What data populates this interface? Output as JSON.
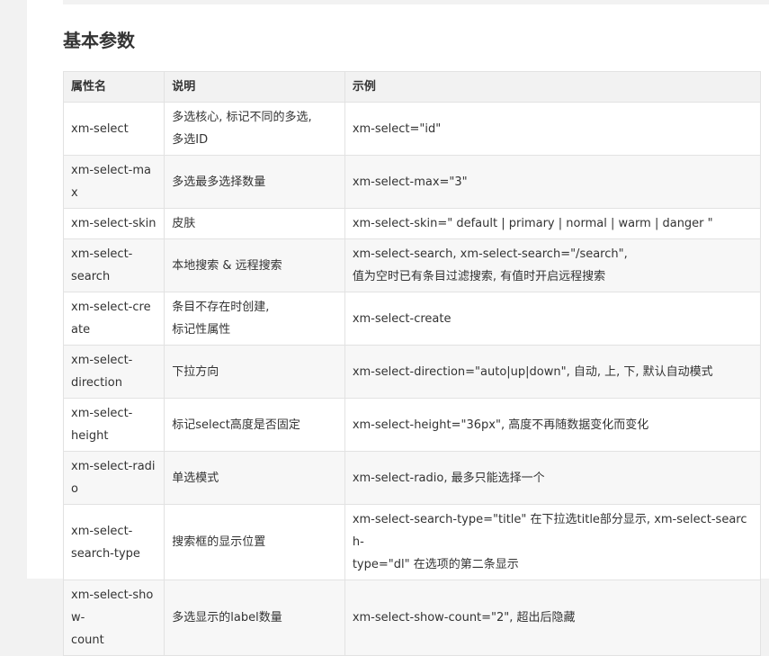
{
  "heading": "基本参数",
  "columns": [
    "属性名",
    "说明",
    "示例"
  ],
  "rows": [
    {
      "name": [
        "xm-select"
      ],
      "desc": [
        "多选核心, 标记不同的多选,",
        "多选ID"
      ],
      "example": [
        "xm-select=\"id\""
      ]
    },
    {
      "name": [
        "xm-select-max"
      ],
      "desc": [
        "多选最多选择数量"
      ],
      "example": [
        "xm-select-max=\"3\""
      ]
    },
    {
      "name": [
        "xm-select-skin"
      ],
      "desc": [
        "皮肤"
      ],
      "example": [
        "xm-select-skin=\" default | primary | normal | warm | danger \""
      ]
    },
    {
      "name": [
        "xm-select-",
        "search"
      ],
      "desc": [
        "本地搜索 & 远程搜索"
      ],
      "example": [
        "xm-select-search, xm-select-search=\"/search\",",
        "值为空时已有条目过滤搜索, 有值时开启远程搜索"
      ]
    },
    {
      "name": [
        "xm-select-create"
      ],
      "desc": [
        "条目不存在时创建,",
        "标记性属性"
      ],
      "example": [
        "xm-select-create"
      ]
    },
    {
      "name": [
        "xm-select-",
        "direction"
      ],
      "desc": [
        "下拉方向"
      ],
      "example": [
        "xm-select-direction=\"auto|up|down\", 自动, 上, 下, 默认自动模式"
      ]
    },
    {
      "name": [
        "xm-select-",
        "height"
      ],
      "desc": [
        "标记select高度是否固定"
      ],
      "example": [
        "xm-select-height=\"36px\", 高度不再随数据变化而变化"
      ]
    },
    {
      "name": [
        "xm-select-radio"
      ],
      "desc": [
        "单选模式"
      ],
      "example": [
        "xm-select-radio, 最多只能选择一个"
      ]
    },
    {
      "name": [
        "xm-select-",
        "search-type"
      ],
      "desc": [
        "搜索框的显示位置"
      ],
      "example": [
        "xm-select-search-type=\"title\" 在下拉选title部分显示, xm-select-search-",
        "type=\"dl\" 在选项的第二条显示"
      ]
    },
    {
      "name": [
        "xm-select-show-",
        "count"
      ],
      "desc": [
        "多选显示的label数量"
      ],
      "example": [
        "xm-select-show-count=\"2\", 超出后隐藏"
      ]
    }
  ]
}
